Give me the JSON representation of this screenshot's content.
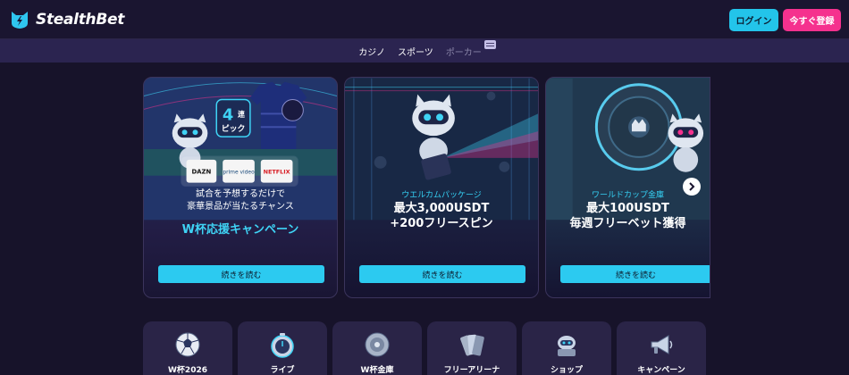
{
  "header": {
    "brand": "StealthBet",
    "login_label": "ログイン",
    "register_label": "今すぐ登録"
  },
  "nav": {
    "items": [
      {
        "label": "カジノ",
        "active": true
      },
      {
        "label": "スポーツ",
        "active": true
      },
      {
        "label": "ポーカー",
        "active": false
      }
    ]
  },
  "promos": [
    {
      "line1": "試合を予想するだけで",
      "line2": "豪華景品が当たるチャンス",
      "headline": "W杯応援キャンペーン",
      "button": "続きを読む",
      "art_badge_top": "4",
      "art_badge_sub": "連",
      "art_badge_bottom": "ピック",
      "partners": [
        "DAZN",
        "prime video",
        "NETFLIX"
      ]
    },
    {
      "tag": "ウエルカムパッケージ",
      "line1": "最大3,000USDT",
      "line2": "+200フリースピン",
      "button": "続きを読む"
    },
    {
      "tag": "ワールドカップ金庫",
      "line1": "最大100USDT",
      "line2": "毎週フリーベット獲得",
      "button": "続きを読む"
    }
  ],
  "carousel": {
    "next_icon": "chevron-right-icon"
  },
  "categories": [
    {
      "label": "W杯2026",
      "icon": "soccer-ball-icon"
    },
    {
      "label": "ライブ",
      "icon": "stopwatch-icon"
    },
    {
      "label": "W杯金庫",
      "icon": "vault-icon"
    },
    {
      "label": "フリーアリーナ",
      "icon": "tickets-icon"
    },
    {
      "label": "ショップ",
      "icon": "shop-icon"
    },
    {
      "label": "キャンペーン",
      "icon": "megaphone-icon"
    }
  ],
  "colors": {
    "accent_cyan": "#2ccaf0",
    "accent_pink": "#f5318e",
    "background": "#17132a",
    "nav_bg": "#2b2450"
  }
}
